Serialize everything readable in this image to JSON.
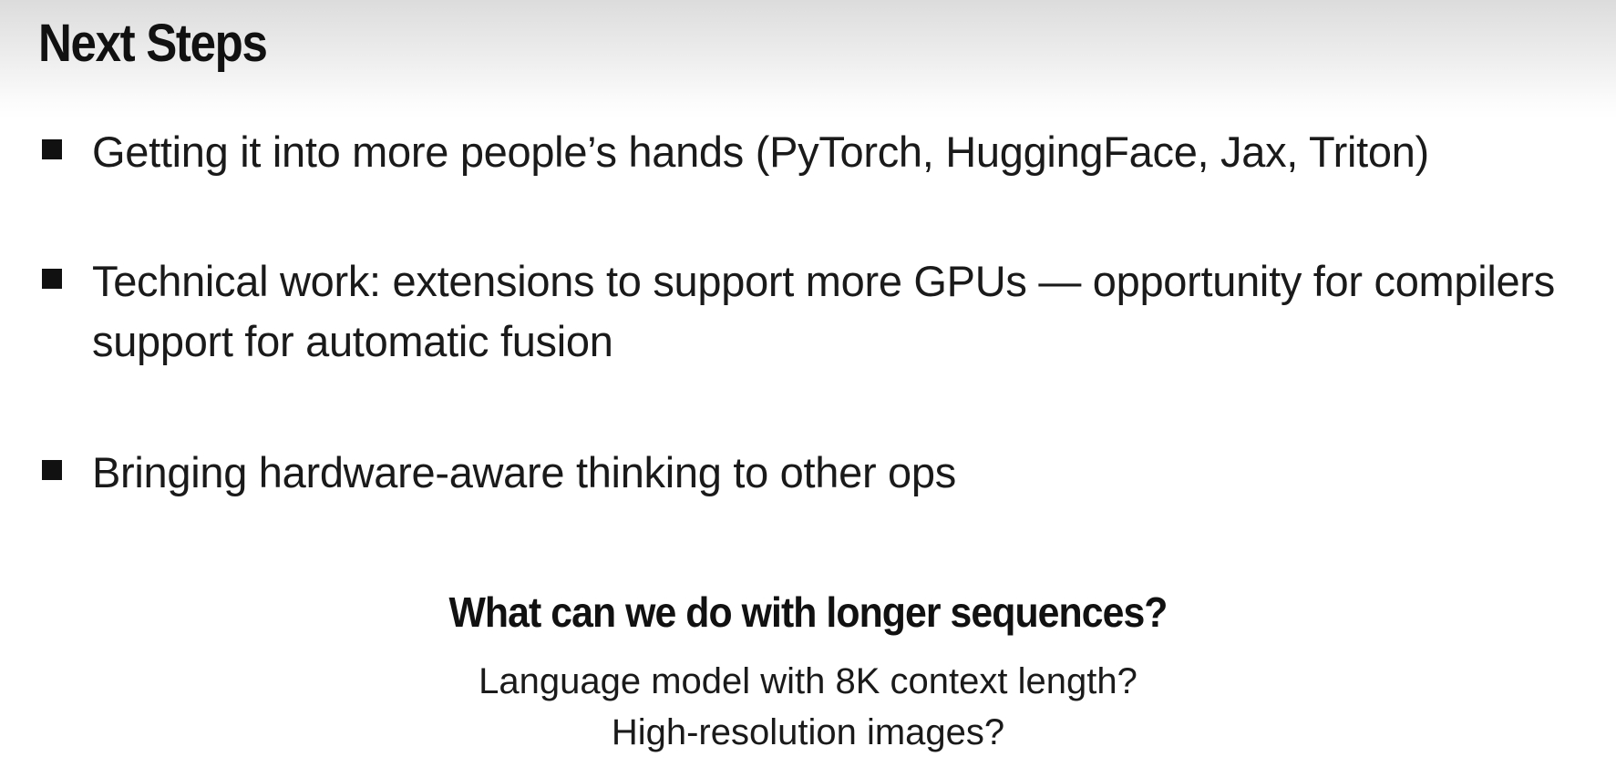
{
  "slide": {
    "title": "Next Steps",
    "bullets": [
      {
        "text": "Getting it into more people’s hands (PyTorch, HuggingFace, Jax, Triton)"
      },
      {
        "text": "Technical work: extensions to support more GPUs — opportunity for compilers support for automatic fusion"
      },
      {
        "text": "Bringing hardware-aware thinking to other ops"
      }
    ],
    "question": "What can we do with longer sequences?",
    "examples": [
      "Language model with 8K context length?",
      "High-resolution images?"
    ]
  }
}
